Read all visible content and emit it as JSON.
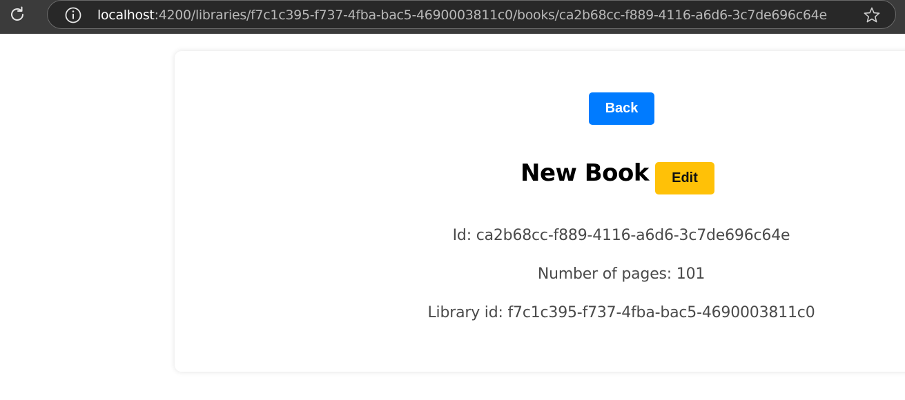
{
  "browser": {
    "url_host": "localhost",
    "url_path": ":4200/libraries/f7c1c395-f737-4fba-bac5-4690003811c0/books/ca2b68cc-f889-4116-a6d6-3c7de696c64e"
  },
  "book": {
    "back_label": "Back",
    "title": "New Book",
    "edit_label": "Edit",
    "id_line": "Id: ca2b68cc-f889-4116-a6d6-3c7de696c64e",
    "pages_line": "Number of pages: 101",
    "library_line": "Library id: f7c1c395-f737-4fba-bac5-4690003811c0"
  },
  "colors": {
    "back_button": "#007bff",
    "edit_button": "#ffc107",
    "browser_bar": "#3b3b3b"
  },
  "icons": {
    "reload": "reload-icon",
    "info": "info-icon",
    "bookmark": "star-icon"
  }
}
